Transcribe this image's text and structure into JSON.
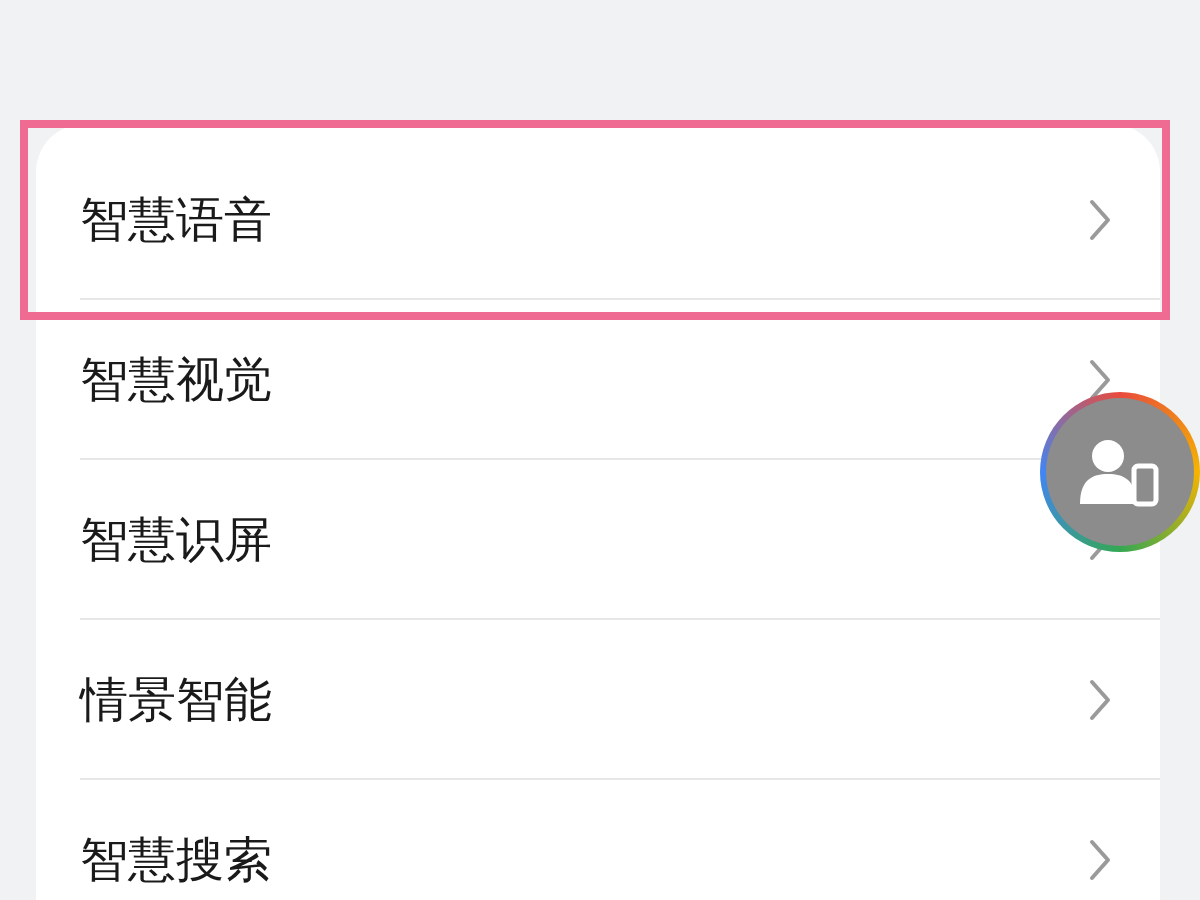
{
  "items": [
    {
      "label": "智慧语音",
      "highlighted": true
    },
    {
      "label": "智慧视觉",
      "highlighted": false
    },
    {
      "label": "智慧识屏",
      "highlighted": false
    },
    {
      "label": "情景智能",
      "highlighted": false
    },
    {
      "label": "智慧搜索",
      "highlighted": false
    }
  ]
}
